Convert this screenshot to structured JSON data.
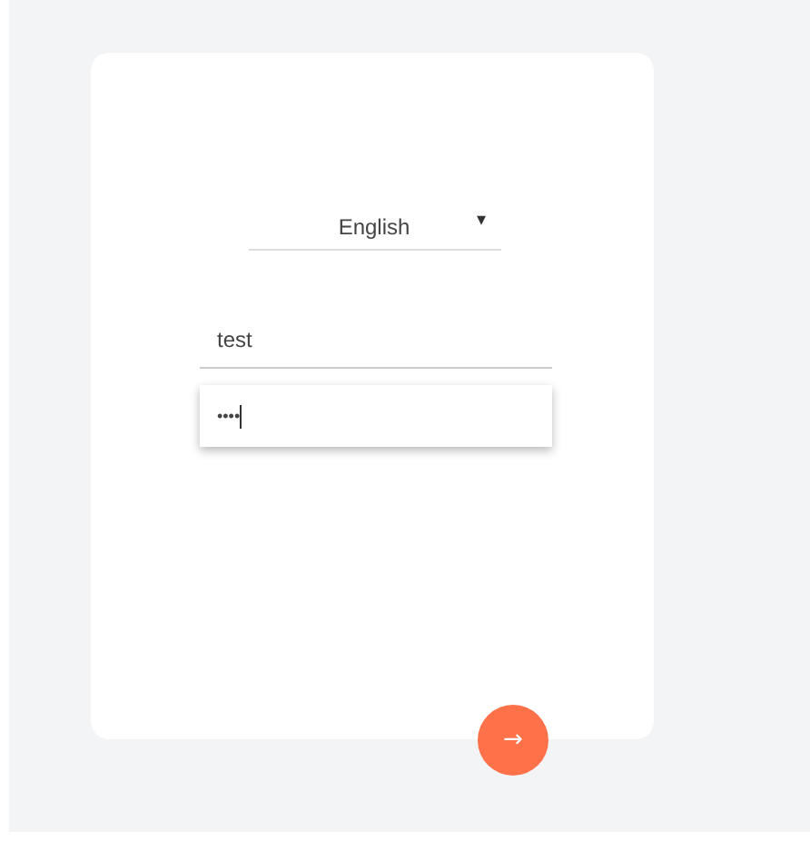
{
  "language_select": {
    "value": "English",
    "caret": "▾"
  },
  "username_field": {
    "value": "test",
    "focused": false
  },
  "password_field": {
    "value": "••••",
    "focused": true
  },
  "submit_button": {
    "label": "→"
  }
}
